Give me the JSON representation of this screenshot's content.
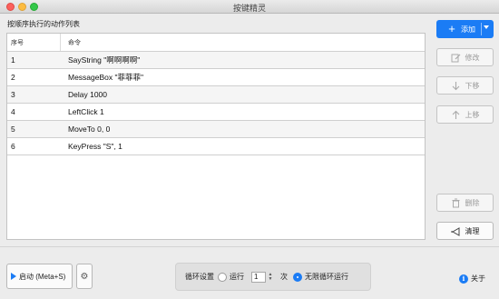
{
  "window": {
    "title": "按键精灵"
  },
  "section_label": "按顺序执行的动作列表",
  "table": {
    "headers": {
      "seq": "序号",
      "cmd": "命令"
    },
    "rows": [
      {
        "seq": "1",
        "cmd": "SayString \"啊啊啊啊\""
      },
      {
        "seq": "2",
        "cmd": "MessageBox \"菲菲菲\""
      },
      {
        "seq": "3",
        "cmd": "Delay 1000"
      },
      {
        "seq": "4",
        "cmd": "LeftClick 1"
      },
      {
        "seq": "5",
        "cmd": "MoveTo 0, 0"
      },
      {
        "seq": "6",
        "cmd": "KeyPress \"S\", 1"
      }
    ]
  },
  "side_buttons": {
    "add": "添加",
    "edit": "修改",
    "down": "下移",
    "up": "上移",
    "delete": "删除",
    "clear": "清理"
  },
  "bottom": {
    "start": "启动 (Meta+S)",
    "loop_label": "循环设置",
    "run_label": "运行",
    "run_count": "1",
    "times_label": "次",
    "infinite_label": "无限循环运行",
    "about": "关于"
  },
  "colors": {
    "accent": "#1b7cf5"
  }
}
